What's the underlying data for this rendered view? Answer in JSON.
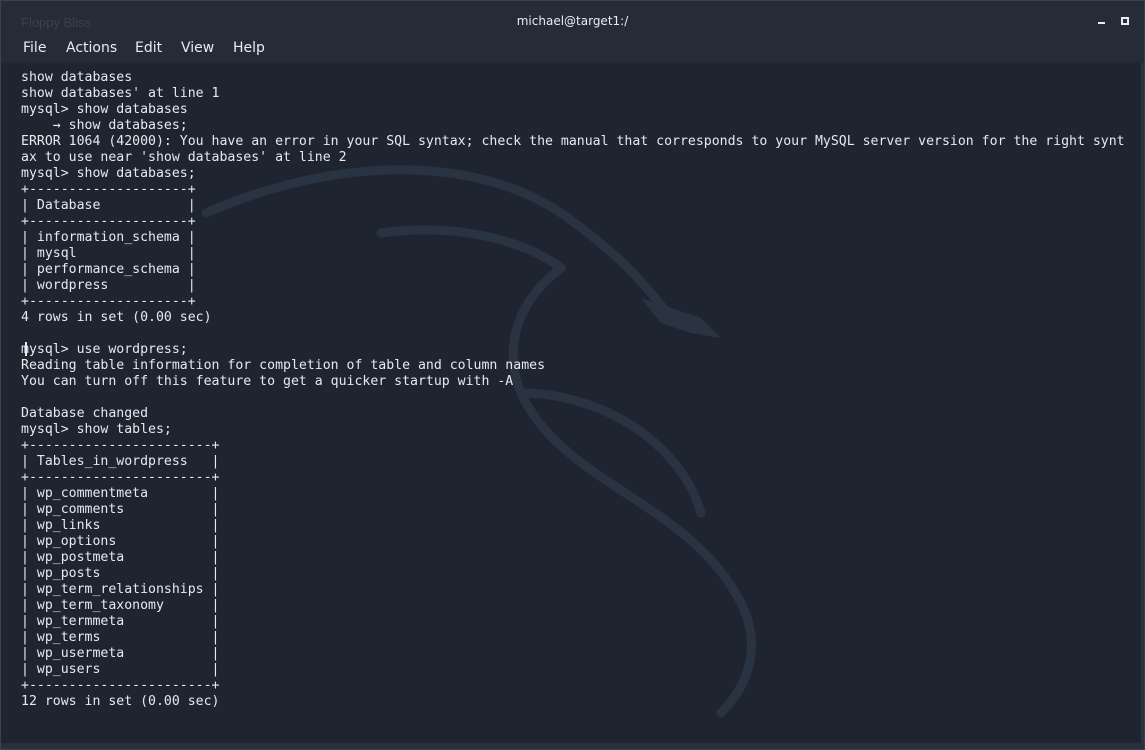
{
  "window": {
    "ghost_title": "Floppy Bliss",
    "title": "michael@target1:/"
  },
  "menu": {
    "file": "File",
    "actions": "Actions",
    "edit": "Edit",
    "view": "View",
    "help": "Help"
  },
  "terminal": {
    "lines": [
      "show databases",
      "show databases' at line 1",
      "mysql> show databases",
      "    → show databases;",
      "ERROR 1064 (42000): You have an error in your SQL syntax; check the manual that corresponds to your MySQL server version for the right synt",
      "ax to use near 'show databases' at line 2",
      "mysql> show databases;",
      "+--------------------+",
      "| Database           |",
      "+--------------------+",
      "| information_schema |",
      "| mysql              |",
      "| performance_schema |",
      "| wordpress          |",
      "+--------------------+",
      "4 rows in set (0.00 sec)",
      "",
      "mysql> use wordpress;",
      "Reading table information for completion of table and column names",
      "You can turn off this feature to get a quicker startup with -A",
      "",
      "Database changed",
      "mysql> show tables;",
      "+-----------------------+",
      "| Tables_in_wordpress   |",
      "+-----------------------+",
      "| wp_commentmeta        |",
      "| wp_comments           |",
      "| wp_links              |",
      "| wp_options            |",
      "| wp_postmeta           |",
      "| wp_posts              |",
      "| wp_term_relationships |",
      "| wp_term_taxonomy      |",
      "| wp_termmeta           |",
      "| wp_terms              |",
      "| wp_usermeta           |",
      "| wp_users              |",
      "+-----------------------+",
      "12 rows in set (0.00 sec)"
    ]
  },
  "colors": {
    "background": "#1e2530",
    "text": "#e6e9ee",
    "titlebar": "#252c38"
  }
}
